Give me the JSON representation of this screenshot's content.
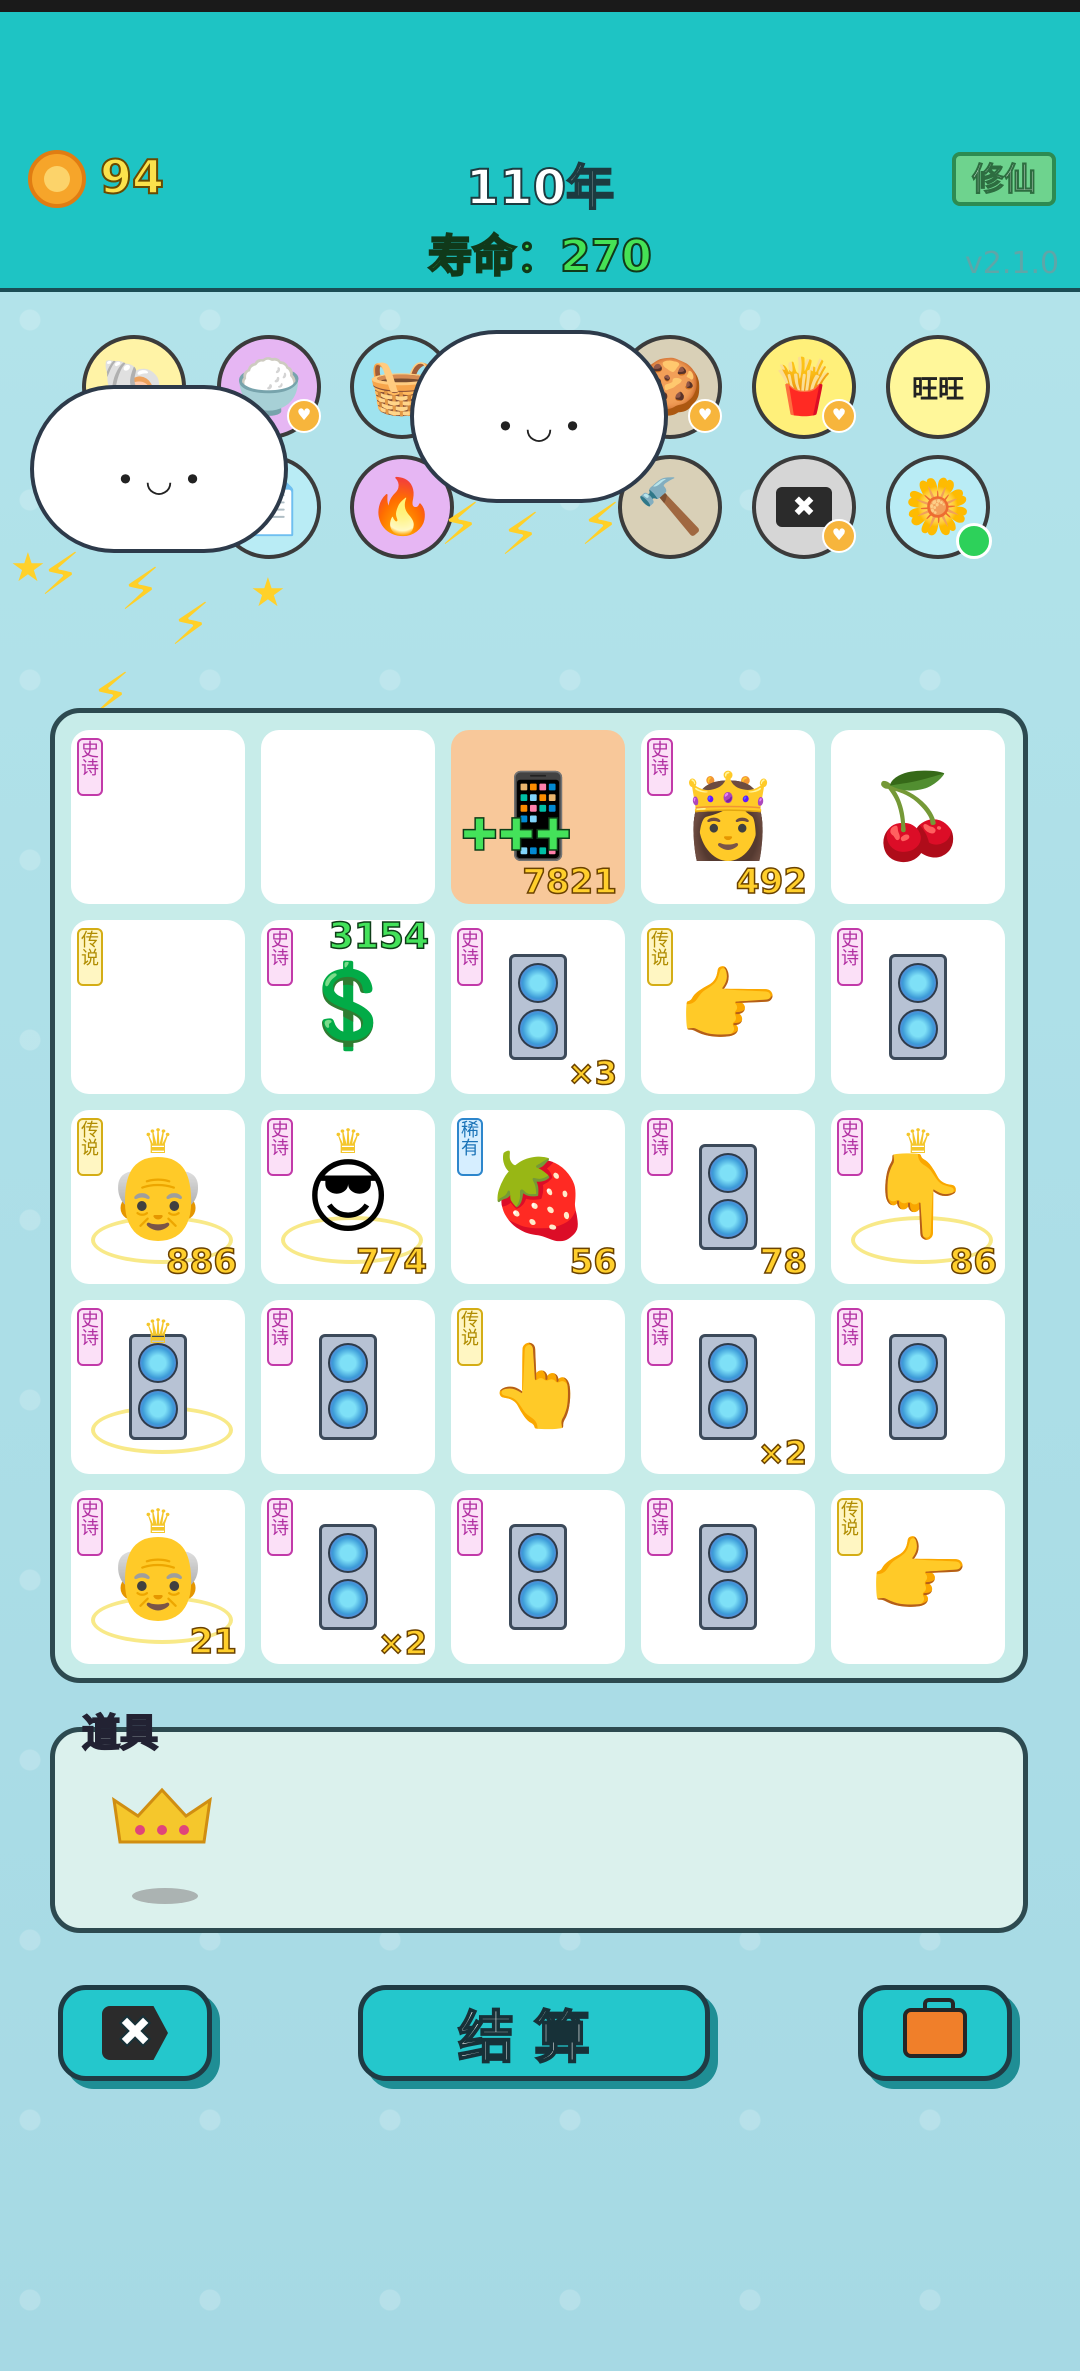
{
  "header": {
    "coins": "94",
    "year": "110年",
    "lifespan": "寿命：270",
    "cultivate_button": "修仙",
    "version": "v2.1.0"
  },
  "abilities_row1": [
    {
      "name": "shell",
      "icon": "🐚"
    },
    {
      "name": "rice-bowl",
      "icon": "🍚",
      "heart": true
    },
    {
      "name": "fruit-basket",
      "icon": "🧺"
    },
    {
      "name": "cloud-cover",
      "icon": ""
    },
    {
      "name": "cookies",
      "icon": "🍪",
      "heart": true
    },
    {
      "name": "fries",
      "icon": "🍟",
      "heart": true
    },
    {
      "name": "wang-wang",
      "icon": "旺"
    }
  ],
  "abilities_row2": [
    {
      "name": "cloud-cover",
      "icon": ""
    },
    {
      "name": "paper",
      "icon": "📄"
    },
    {
      "name": "fire-box",
      "icon": "🔥"
    },
    {
      "name": "lightning",
      "icon": "⚡"
    },
    {
      "name": "hammer",
      "icon": "🔨"
    },
    {
      "name": "remove-tag",
      "icon": "✖",
      "heart": true
    },
    {
      "name": "flower-pot",
      "icon": "🌼"
    }
  ],
  "board": {
    "cells": [
      {
        "tag": "史诗",
        "type": "epic",
        "icon": "",
        "num": ""
      },
      {
        "tag": "",
        "type": "",
        "icon": "",
        "num": ""
      },
      {
        "tag": "",
        "type": "",
        "icon": "📱",
        "num": "7821",
        "highlight": true
      },
      {
        "tag": "史诗",
        "type": "epic",
        "icon": "👸",
        "num": "492"
      },
      {
        "tag": "",
        "type": "",
        "icon": "🍒",
        "num": ""
      },
      {
        "tag": "传说",
        "type": "legend",
        "icon": "",
        "num": ""
      },
      {
        "tag": "史诗",
        "type": "epic",
        "icon": "💲",
        "num": "",
        "float": "3154"
      },
      {
        "tag": "史诗",
        "type": "epic",
        "icon": "gpu",
        "num": "×3"
      },
      {
        "tag": "传说",
        "type": "legend",
        "icon": "👉",
        "num": ""
      },
      {
        "tag": "史诗",
        "type": "epic",
        "icon": "gpu",
        "num": ""
      },
      {
        "tag": "传说",
        "type": "legend",
        "icon": "👴",
        "num": "886",
        "crown": true
      },
      {
        "tag": "史诗",
        "type": "epic",
        "icon": "😎",
        "num": "774",
        "crown": true
      },
      {
        "tag": "稀有",
        "type": "rare",
        "icon": "🍓",
        "num": "56"
      },
      {
        "tag": "史诗",
        "type": "epic",
        "icon": "gpu",
        "num": "78"
      },
      {
        "tag": "史诗",
        "type": "epic",
        "icon": "👇",
        "num": "86",
        "crown": true
      },
      {
        "tag": "史诗",
        "type": "epic",
        "icon": "gpu",
        "num": "",
        "crown": true
      },
      {
        "tag": "史诗",
        "type": "epic",
        "icon": "gpu",
        "num": ""
      },
      {
        "tag": "传说",
        "type": "legend",
        "icon": "👆",
        "num": ""
      },
      {
        "tag": "史诗",
        "type": "epic",
        "icon": "gpu",
        "num": "×2"
      },
      {
        "tag": "史诗",
        "type": "epic",
        "icon": "gpu",
        "num": ""
      },
      {
        "tag": "史诗",
        "type": "epic",
        "icon": "👴",
        "num": "21",
        "crown": true
      },
      {
        "tag": "史诗",
        "type": "epic",
        "icon": "gpu",
        "num": "×2"
      },
      {
        "tag": "史诗",
        "type": "epic",
        "icon": "gpu",
        "num": ""
      },
      {
        "tag": "史诗",
        "type": "epic",
        "icon": "gpu",
        "num": ""
      },
      {
        "tag": "传说",
        "type": "legend",
        "icon": "👉",
        "num": ""
      }
    ]
  },
  "items": {
    "label": "道具",
    "list": [
      {
        "name": "crown"
      }
    ]
  },
  "buttons": {
    "remove_icon": "✖",
    "settle": "结算",
    "bag_icon": "briefcase"
  },
  "colors": {
    "header_bg": "#1ec4c4",
    "board_bg": "#c7ece9",
    "number_gold": "#ffcf2c",
    "life_green": "#45e255"
  }
}
